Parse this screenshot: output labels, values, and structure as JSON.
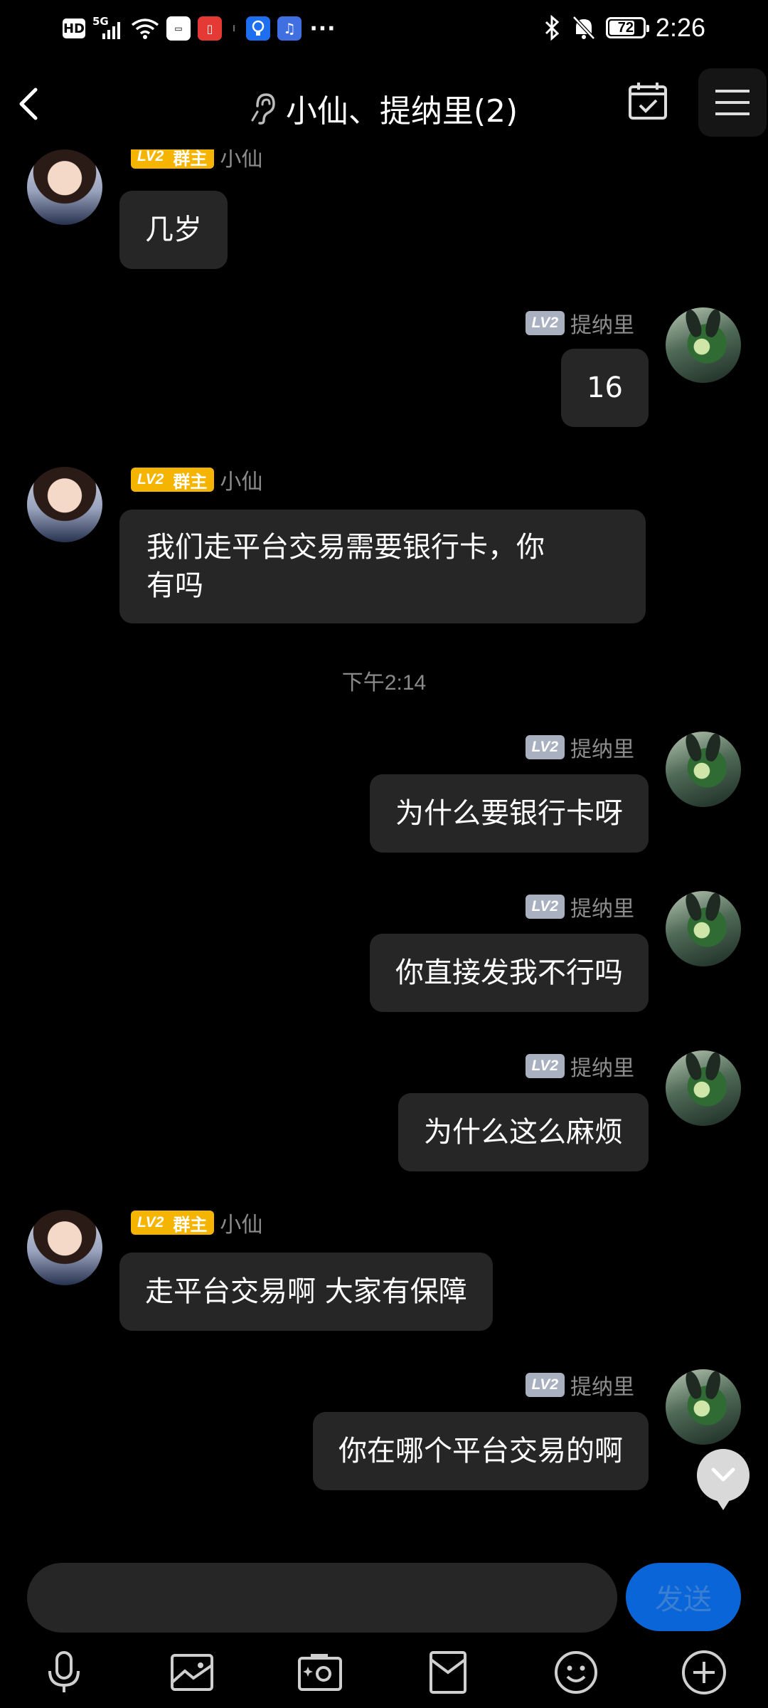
{
  "status_bar": {
    "network_badge": "HD",
    "network_type": "5G",
    "battery_level": "72",
    "time": "2:26",
    "more_indicator": "···"
  },
  "header": {
    "title": "小仙、提纳里(2)",
    "icons": [
      "back-arrow-icon",
      "ear-icon",
      "calendar-check-icon",
      "menu-icon"
    ]
  },
  "badges": {
    "level": "LV2",
    "owner_role": "群主"
  },
  "messages": [
    {
      "side": "left",
      "sender": "小仙",
      "owner": true,
      "text": "几岁"
    },
    {
      "side": "right",
      "sender": "提纳里",
      "text": "16"
    },
    {
      "side": "left",
      "sender": "小仙",
      "owner": true,
      "text_lines": [
        "我们走平台交易需要银行卡，你",
        "有吗"
      ]
    },
    {
      "side": "right",
      "sender": "提纳里",
      "text": "为什么要银行卡呀"
    },
    {
      "side": "right",
      "sender": "提纳里",
      "text": "你直接发我不行吗"
    },
    {
      "side": "right",
      "sender": "提纳里",
      "text": "为什么这么麻烦"
    },
    {
      "side": "left",
      "sender": "小仙",
      "owner": true,
      "text": "走平台交易啊 大家有保障"
    },
    {
      "side": "right",
      "sender": "提纳里",
      "text": "你在哪个平台交易的啊"
    }
  ],
  "timestamp": "下午2:14",
  "input": {
    "value": "",
    "placeholder": "",
    "send_label": "发送"
  },
  "toolbar": {
    "items": [
      "microphone-icon",
      "image-icon",
      "camera-icon",
      "red-packet-icon",
      "emoji-icon",
      "plus-icon"
    ]
  },
  "colors": {
    "background": "#000000",
    "bubble": "#262626",
    "owner_badge": "#f5b400",
    "level_badge_gray": "#a9b0bf",
    "send_button": "#0a66d8"
  }
}
